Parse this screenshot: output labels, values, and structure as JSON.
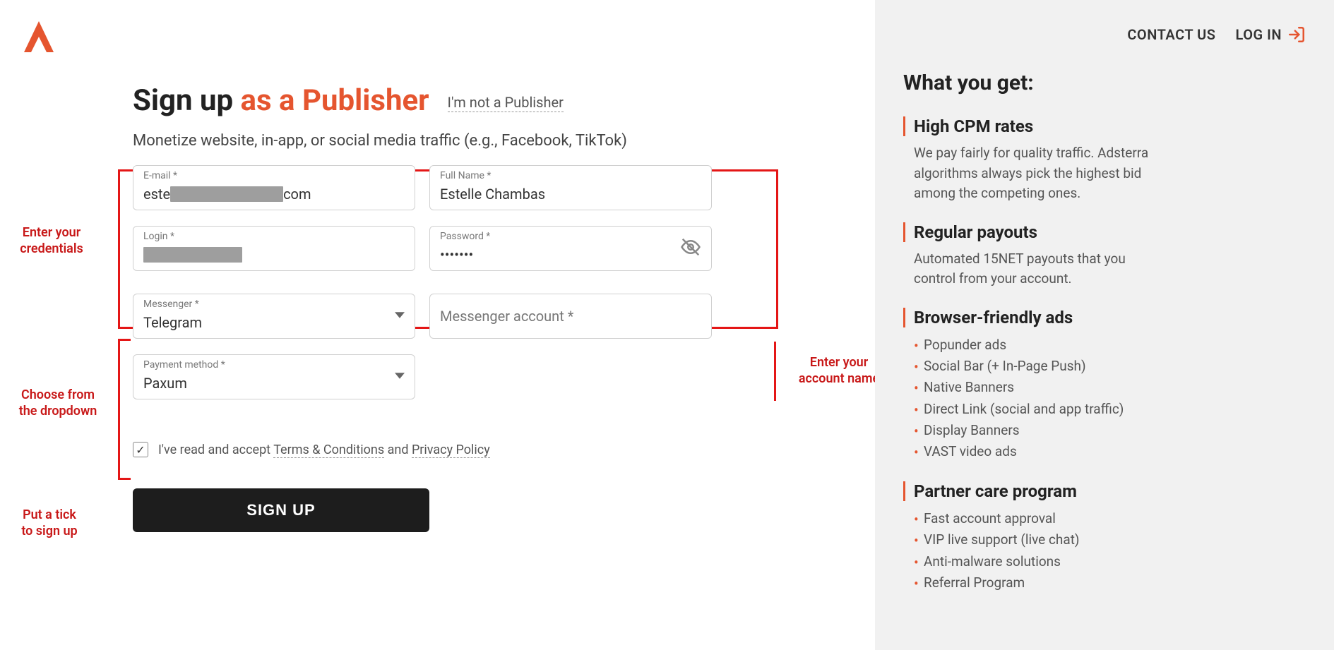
{
  "header": {
    "contact": "CONTACT US",
    "login": "LOG IN"
  },
  "page": {
    "title_prefix": "Sign up ",
    "title_accent": "as a Publisher",
    "switch_link": "I'm not a Publisher",
    "subtitle": "Monetize website, in-app, or social media traffic (e.g., Facebook, TikTok)"
  },
  "form": {
    "email_label": "E-mail *",
    "email_prefix": "este",
    "email_suffix": "com",
    "fullname_label": "Full Name *",
    "fullname_value": "Estelle Chambas",
    "login_label": "Login *",
    "password_label": "Password *",
    "password_value": "•••••••",
    "messenger_label": "Messenger *",
    "messenger_value": "Telegram",
    "messenger_account_placeholder": "Messenger account *",
    "payment_label": "Payment method *",
    "payment_value": "Paxum",
    "terms_prefix": "I've read and accept ",
    "terms_link1": "Terms & Conditions",
    "terms_mid": " and ",
    "terms_link2": "Privacy Policy",
    "signup_button": "SIGN UP"
  },
  "annotations": {
    "credentials": "Enter your\ncredentials",
    "dropdown": "Choose from\nthe dropdown",
    "tick": "Put a tick\n to sign up",
    "account_name": "Enter your\naccount name"
  },
  "sidebar": {
    "heading": "What you get:",
    "benefits": [
      {
        "title": "High CPM rates",
        "desc": "We pay fairly for quality traffic. Adsterra algorithms always pick the highest bid among the competing ones."
      },
      {
        "title": "Regular payouts",
        "desc": "Automated 15NET payouts that you control from your account."
      },
      {
        "title": "Browser-friendly ads",
        "items": [
          "Popunder ads",
          "Social Bar (+ In-Page Push)",
          "Native Banners",
          "Direct Link (social and app traffic)",
          "Display Banners",
          "VAST video ads"
        ]
      },
      {
        "title": "Partner care program",
        "items": [
          "Fast account approval",
          "VIP live support (live chat)",
          "Anti-malware solutions",
          "Referral Program"
        ]
      }
    ]
  }
}
